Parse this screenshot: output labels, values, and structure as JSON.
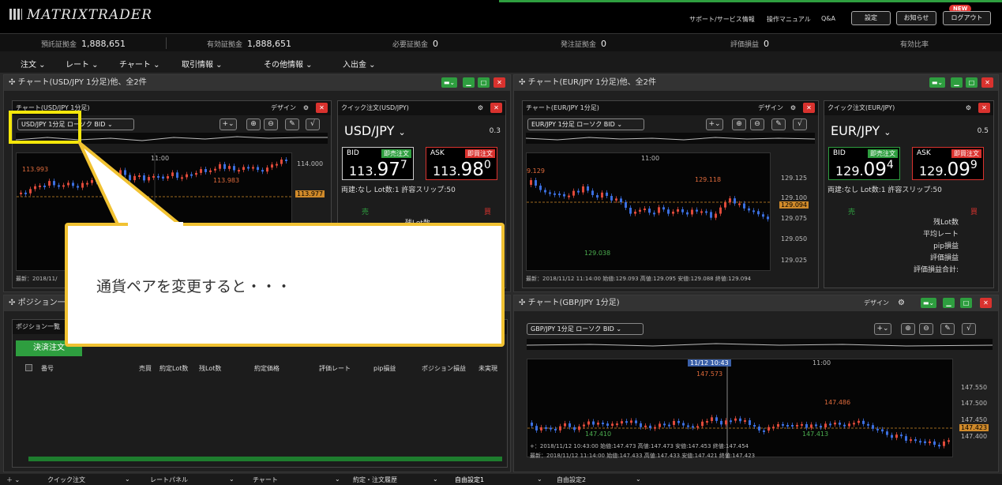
{
  "header": {
    "logo": "MATRIXTRADER",
    "links": [
      "サポート/サービス情報",
      "操作マニュアル",
      "Q&A"
    ],
    "settings_btn": "設定",
    "notice_btn": "お知らせ",
    "new_badge": "NEW",
    "logout_btn": "ログアウト"
  },
  "account": [
    {
      "label": "預託証拠金",
      "value": "1,888,651"
    },
    {
      "label": "有効証拠金",
      "value": "1,888,651"
    },
    {
      "label": "必要証拠金",
      "value": "0"
    },
    {
      "label": "発注証拠金",
      "value": "0"
    },
    {
      "label": "評価損益",
      "value": "0"
    },
    {
      "label": "有効比率",
      "value": ""
    }
  ],
  "menu": [
    "注文",
    "レート",
    "チャート",
    "取引情報",
    "その他情報",
    "入出金"
  ],
  "pane1": {
    "title": "チャート(USD/JPY 1分足)他、全2件"
  },
  "pane2": {
    "title": "チャート(EUR/JPY 1分足)他、全2件"
  },
  "usd": {
    "chart_title": "チャート(USD/JPY 1分足)",
    "design": "デザイン",
    "selector": "USD/JPY 1分足 ローソク BID",
    "time": "11:00",
    "hi": "113.993",
    "mid": "113.983",
    "y_top": "114.000",
    "cur": "113.977",
    "last": "最新：2018/11/",
    "quick_title": "クイック注文(USD/JPY)",
    "pair": "USD/JPY",
    "spread": "0.3",
    "bid_label": "BID",
    "bid_tag": "即売注文",
    "bid_big": "113.",
    "bid_mid": "97",
    "bid_sup": "7",
    "ask_label": "ASK",
    "ask_tag": "即買注文",
    "ask_big": "113.",
    "ask_mid": "98",
    "ask_sup": "0",
    "info": "両建:なし Lot数:1 許容スリップ:50",
    "sell": "売",
    "buy": "買",
    "zan": "残Lot数"
  },
  "eur": {
    "chart_title": "チャート(EUR/JPY 1分足)",
    "design": "デザイン",
    "selector": "EUR/JPY 1分足 ローソク BID",
    "time": "11:00",
    "hi_left": "9.129",
    "hi": "129.118",
    "lo": "129.038",
    "yticks": [
      "129.125",
      "129.100",
      "129.075",
      "129.050",
      "129.025"
    ],
    "cur": "129.094",
    "last": "最新：2018/11/12 11:14:00 始値:129.093 高値:129.095 安値:129.088 終値:129.094",
    "quick_title": "クイック注文(EUR/JPY)",
    "pair": "EUR/JPY",
    "spread": "0.5",
    "bid_label": "BID",
    "bid_tag": "即売注文",
    "bid_big": "129.",
    "bid_mid": "09",
    "bid_sup": "4",
    "ask_label": "ASK",
    "ask_tag": "即買注文",
    "ask_big": "129.",
    "ask_mid": "09",
    "ask_sup": "9",
    "info": "両建:なし Lot数:1 許容スリップ:50",
    "sell": "売",
    "buy": "買",
    "stats": [
      "残Lot数",
      "平均レート",
      "pip損益",
      "評価損益",
      "評価損益合計:"
    ]
  },
  "gbp": {
    "title": "チャート(GBP/JPY 1分足)",
    "design": "デザイン",
    "selector": "GBP/JPY 1分足 ローソク BID",
    "cursor_time": "11/12 10:43",
    "time": "11:00",
    "hi": "147.573",
    "mid": "147.486",
    "lo1": "147.410",
    "lo2": "147.413",
    "yticks": [
      "147.550",
      "147.500",
      "147.450",
      "147.400"
    ],
    "cur": "147.423",
    "cursor": "+：2018/11/12 10:43:00 始値:147.473 高値:147.473 安値:147.453 終値:147.454",
    "last": "最新：2018/11/12 11:14:00 始値:147.433 高値:147.433 安値:147.421 終値:147.423"
  },
  "positions": {
    "title": "ポジション一",
    "tab": "ポジション一覧",
    "settle_btn": "決済注文",
    "cols": [
      "番号",
      "売買",
      "約定Lot数",
      "残Lot数",
      "約定価格",
      "評価レート",
      "pip損益",
      "ポジション損益",
      "未実現"
    ]
  },
  "callout": "通貨ペアを変更すると・・・",
  "bottom_tabs": [
    "クイック注文",
    "レートパネル",
    "チャート",
    "約定・注文履歴",
    "自由設定1",
    "自由設定2"
  ]
}
